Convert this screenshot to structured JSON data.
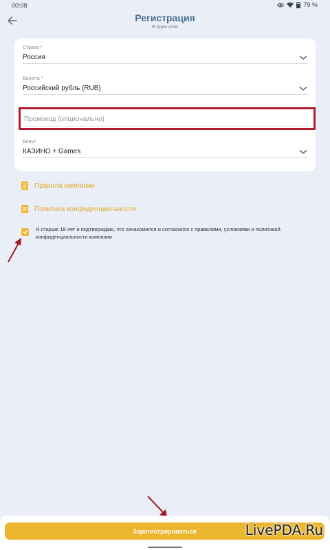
{
  "status_bar": {
    "time": "00:08",
    "battery": "79 %",
    "icons": [
      "eye-icon",
      "wifi-icon",
      "battery-icon"
    ]
  },
  "header": {
    "title": "Регистрация",
    "subtitle": "В один клик",
    "back_icon": "arrow-left-icon"
  },
  "form": {
    "country": {
      "label": "Страна *",
      "value": "Россия"
    },
    "currency": {
      "label": "Валюта *",
      "value": "Российский рубль (RUB)"
    },
    "promo": {
      "placeholder": "Промокод (опционально)",
      "value": ""
    },
    "bonus": {
      "label": "Бонус",
      "value": "КАЗИНО + Games"
    }
  },
  "links": {
    "rules": "Правила компании",
    "privacy": "Политика конфиденциальности"
  },
  "agreement": {
    "checked": true,
    "text": "Я старше 18 лет и подтверждаю, что ознакомился и согласился с правилами, условиями и политикой конфиденциальности компании"
  },
  "register_button": "Зарегистрироваться",
  "watermark": "LivePDA.Ru",
  "colors": {
    "accent": "#ebb52e",
    "highlight_border": "#b01c2e",
    "title": "#4b6f8e",
    "background": "#eaeef6"
  }
}
